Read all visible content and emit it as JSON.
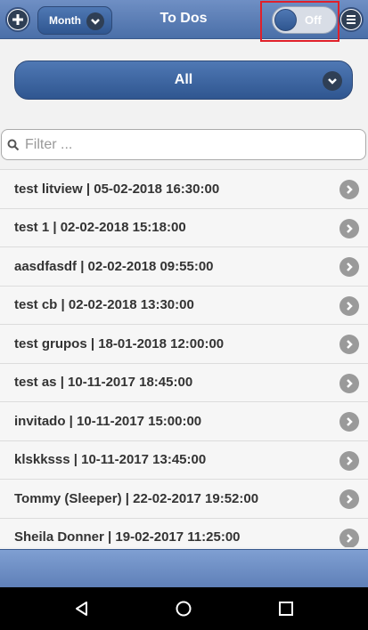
{
  "header": {
    "title": "To Dos",
    "period_select": "Month",
    "toggle_label": "Off"
  },
  "filter": {
    "selected": "All"
  },
  "search": {
    "placeholder": "Filter ..."
  },
  "todos": [
    {
      "label": "test litview | 05-02-2018 16:30:00"
    },
    {
      "label": "test 1 | 02-02-2018 15:18:00"
    },
    {
      "label": "aasdfasdf | 02-02-2018 09:55:00"
    },
    {
      "label": "test cb | 02-02-2018 13:30:00"
    },
    {
      "label": "test grupos | 18-01-2018 12:00:00"
    },
    {
      "label": "test as | 10-11-2017 18:45:00"
    },
    {
      "label": "invitado | 10-11-2017 15:00:00"
    },
    {
      "label": "klskksss | 10-11-2017 13:45:00"
    },
    {
      "label": "Tommy (Sleeper) | 22-02-2017 19:52:00"
    },
    {
      "label": "Sheila Donner | 19-02-2017 11:25:00"
    }
  ],
  "colors": {
    "header": "#4a6fa8",
    "accent": "#2f5690",
    "highlight": "#e0202a"
  },
  "icons": [
    "plus-icon",
    "menu-icon",
    "chevron-down-icon",
    "chevron-right-icon",
    "search-icon",
    "back-icon",
    "home-icon",
    "recent-apps-icon"
  ]
}
